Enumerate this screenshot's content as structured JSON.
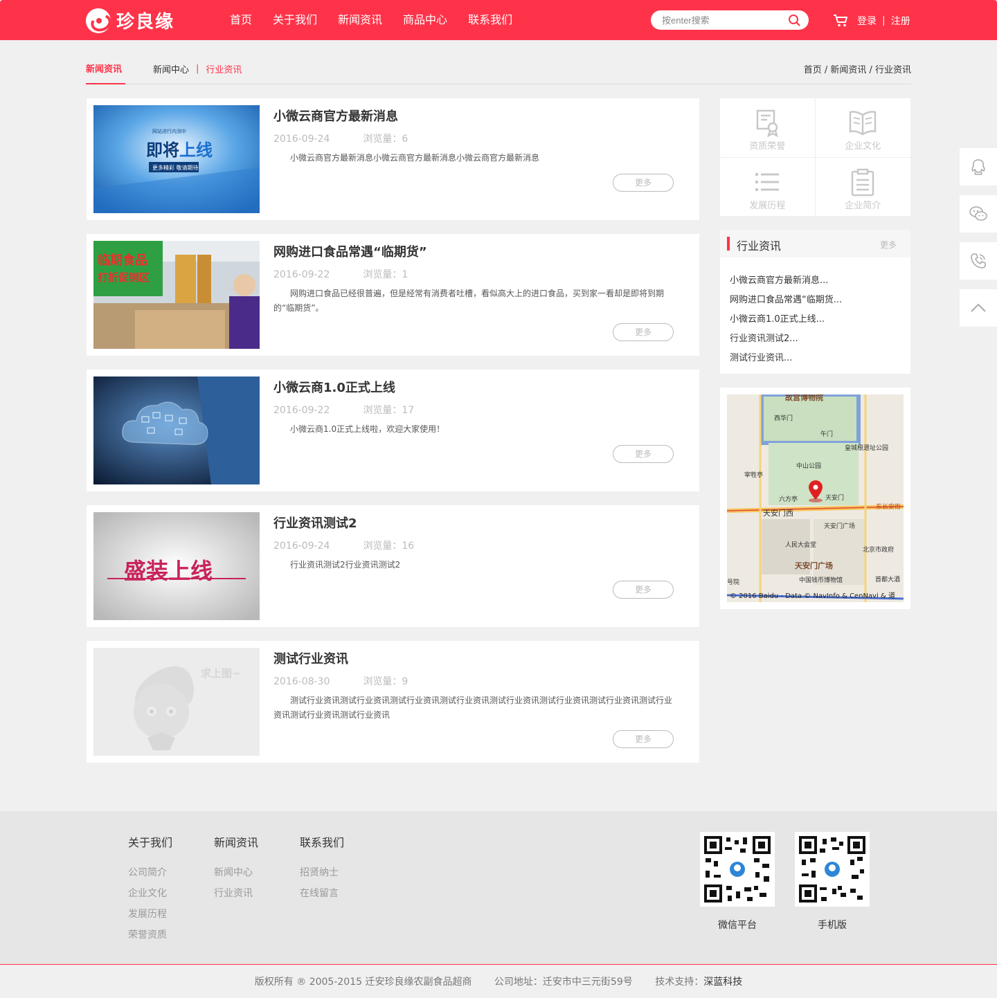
{
  "header": {
    "logo_text": "珍良缘",
    "nav": [
      "首页",
      "关于我们",
      "新闻资讯",
      "商品中心",
      "联系我们"
    ],
    "search_placeholder": "按enter搜索",
    "login": "登录",
    "separator": "|",
    "register": "注册"
  },
  "subnav": {
    "current": "新闻资讯",
    "links": [
      "新闻中心",
      "行业资讯"
    ],
    "divider": "|",
    "breadcrumb": "首页 / 新闻资讯 / 行业资讯"
  },
  "thumbs": {
    "a1_small": "网站进行内测中",
    "a1_big1": "即将",
    "a1_big2": "上线",
    "a1_sub": "更多精彩 敬请期待",
    "a2_sign1": "临期食品",
    "a2_sign2": "打折促销区",
    "a4_text": "盛装上线",
    "a5_text": "求上图~"
  },
  "articles": [
    {
      "title": "小微云商官方最新消息",
      "date": "2016-09-24",
      "views": "浏览量：6",
      "desc": "小微云商官方最新消息小微云商官方最新消息小微云商官方最新消息",
      "more": "更多"
    },
    {
      "title": "网购进口食品常遇“临期货”",
      "date": "2016-09-22",
      "views": "浏览量：1",
      "desc": "网购进口食品已经很普遍，但是经常有消费者吐槽，看似高大上的进口食品，买到家一看却是即将到期的“临期货”。",
      "more": "更多"
    },
    {
      "title": "小微云商1.0正式上线",
      "date": "2016-09-22",
      "views": "浏览量：17",
      "desc": "小微云商1.0正式上线啦，欢迎大家使用！",
      "more": "更多"
    },
    {
      "title": "行业资讯测试2",
      "date": "2016-09-24",
      "views": "浏览量：16",
      "desc": "行业资讯测试2行业资讯测试2",
      "more": "更多"
    },
    {
      "title": "测试行业资讯",
      "date": "2016-08-30",
      "views": "浏览量：9",
      "desc": "测试行业资讯测试行业资讯测试行业资讯测试行业资讯测试行业资讯测试行业资讯测试行业资讯测试行业资讯测试行业资讯测试行业资讯",
      "more": "更多"
    }
  ],
  "sidebar": {
    "grid": [
      "资质荣誉",
      "企业文化",
      "发展历程",
      "企业简介"
    ],
    "news_title": "行业资讯",
    "news_more": "更多",
    "news_items": [
      "小微云商官方最新消息...",
      "网购进口食品常遇“临期货...",
      "小微云商1.0正式上线...",
      "行业资讯测试2...",
      "测试行业资讯..."
    ]
  },
  "map": {
    "labels": [
      "故宫博物院",
      "西华门",
      "午门",
      "皇城根遗址公园",
      "中山公园",
      "宰牲亭",
      "六方亭",
      "天安门",
      "天安门西",
      "东长安街",
      "天安门广场",
      "人民大会堂",
      "北京市政府",
      "天安门广场",
      "中国钱币博物馆",
      "首都大酒",
      "号院"
    ],
    "copyright": "© 2016 Baidu - Data © NavInfo & CenNavi & 道"
  },
  "footer": {
    "cols": [
      {
        "title": "关于我们",
        "links": [
          "公司简介",
          "企业文化",
          "发展历程",
          "荣誉资质"
        ]
      },
      {
        "title": "新闻资讯",
        "links": [
          "新闻中心",
          "行业资讯"
        ]
      },
      {
        "title": "联系我们",
        "links": [
          "招贤纳士",
          "在线留言"
        ]
      }
    ],
    "qr": [
      "微信平台",
      "手机版"
    ],
    "copyright": "版权所有 ® 2005-2015 迁安珍良缘农副食品超商",
    "address": "公司地址：迁安市中三元街59号",
    "support_label": "技术支持：",
    "support_name": "深蓝科技"
  },
  "colors": {
    "brand": "#fe3349",
    "bg": "#f0f0f0"
  }
}
